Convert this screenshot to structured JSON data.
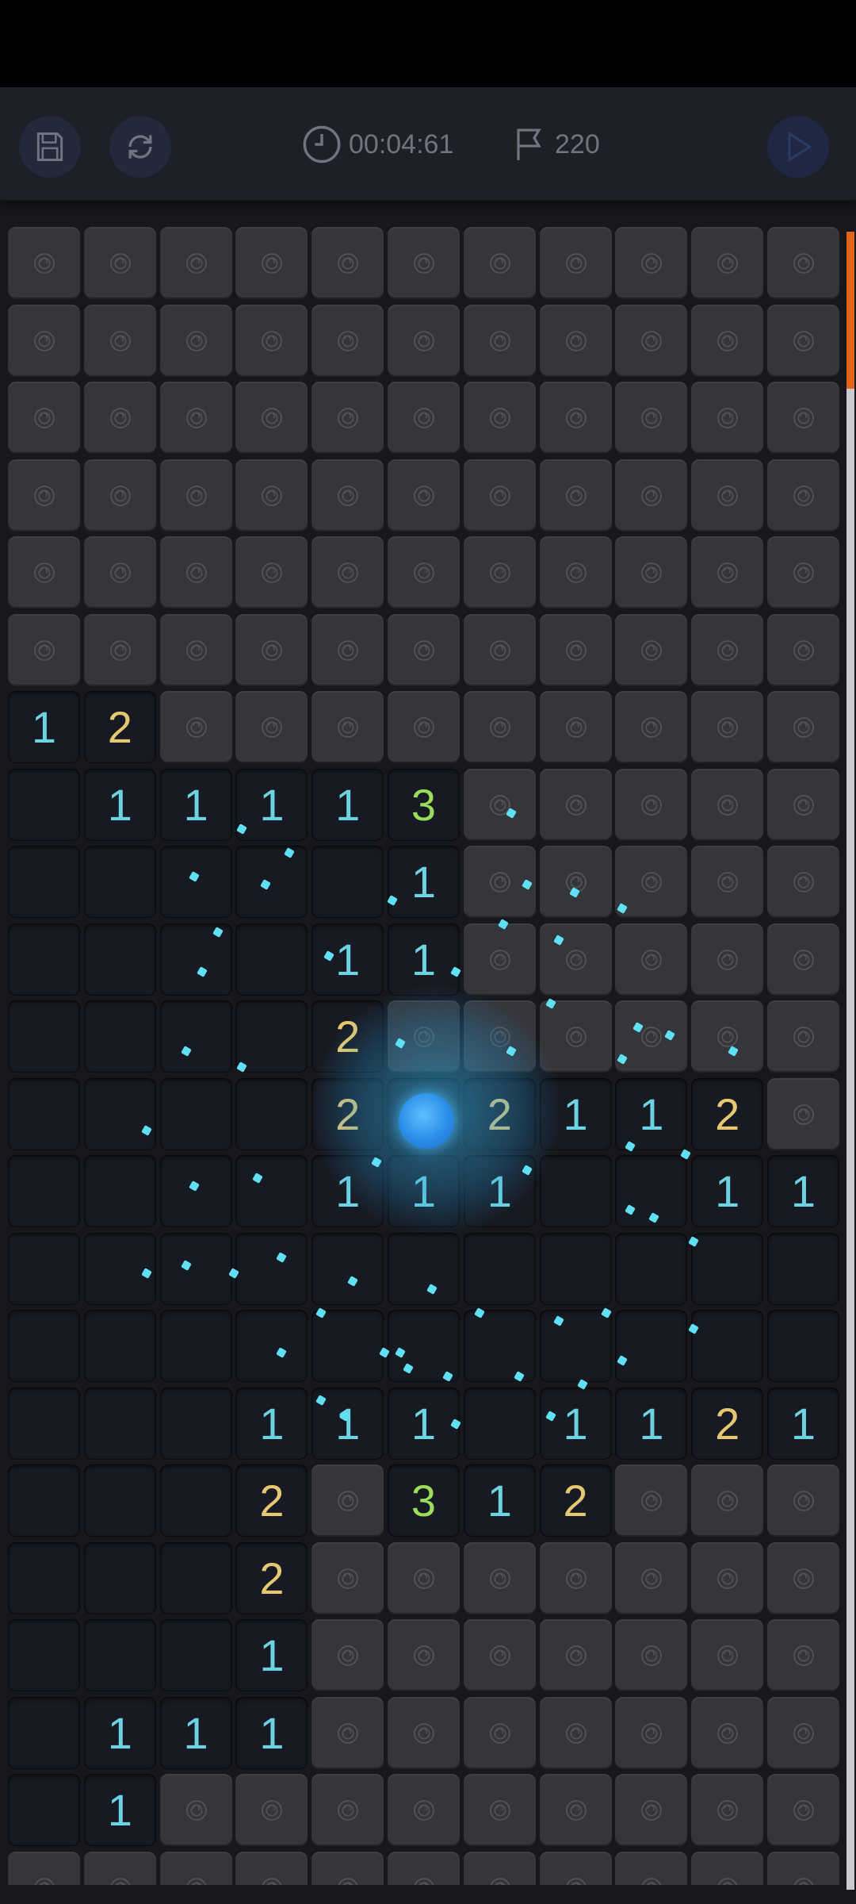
{
  "toolbar": {
    "save_icon": "save-icon",
    "restart_icon": "refresh-icon",
    "timer": "00:04:61",
    "flags": "220",
    "play_icon": "play-icon"
  },
  "colors": {
    "one": "#6cd3e3",
    "two": "#e6c872",
    "three": "#9bdc5a",
    "covered": "#35363b",
    "revealed": "#171a22",
    "scroll_thumb": "#e0661a"
  },
  "board": {
    "cols": 11,
    "rows": [
      "CCCCCCCCCCC",
      "CCCCCCCCCCC",
      "CCCCCCCCCCC",
      "CCCCCCCCCCC",
      "CCCCCCCCCCC",
      "CCCCCCCCCCC",
      "12CCCCCCCCC",
      "01111 3CCCCC",
      "000001CCCCC",
      "00001 1CCCCC",
      "00002CCCCCC",
      "00002 021 12C",
      "00001 11 0011",
      "00000000000",
      "00000000000",
      "00011100 1121",
      "00023 12CCC",
      "0002CCCCCCC",
      "0001CCCCCCC",
      "0111CCCCCCC",
      "01CCCCCCCCC",
      "CCCCCCCCCCC"
    ],
    "grid": [
      [
        "C",
        "C",
        "C",
        "C",
        "C",
        "C",
        "C",
        "C",
        "C",
        "C",
        "C"
      ],
      [
        "C",
        "C",
        "C",
        "C",
        "C",
        "C",
        "C",
        "C",
        "C",
        "C",
        "C"
      ],
      [
        "C",
        "C",
        "C",
        "C",
        "C",
        "C",
        "C",
        "C",
        "C",
        "C",
        "C"
      ],
      [
        "C",
        "C",
        "C",
        "C",
        "C",
        "C",
        "C",
        "C",
        "C",
        "C",
        "C"
      ],
      [
        "C",
        "C",
        "C",
        "C",
        "C",
        "C",
        "C",
        "C",
        "C",
        "C",
        "C"
      ],
      [
        "C",
        "C",
        "C",
        "C",
        "C",
        "C",
        "C",
        "C",
        "C",
        "C",
        "C"
      ],
      [
        "1",
        "2",
        "C",
        "C",
        "C",
        "C",
        "C",
        "C",
        "C",
        "C",
        "C"
      ],
      [
        "0",
        "1",
        "1",
        "1",
        "1",
        "3",
        "C",
        "C",
        "C",
        "C",
        "C"
      ],
      [
        "0",
        "0",
        "0",
        "0",
        "0",
        "1",
        "C",
        "C",
        "C",
        "C",
        "C"
      ],
      [
        "0",
        "0",
        "0",
        "0",
        "1",
        "1",
        "C",
        "C",
        "C",
        "C",
        "C"
      ],
      [
        "0",
        "0",
        "0",
        "0",
        "2",
        "C",
        "C",
        "C",
        "C",
        "C",
        "C"
      ],
      [
        "0",
        "0",
        "0",
        "0",
        "2",
        "0",
        "2",
        "1",
        "1",
        "2",
        "C"
      ],
      [
        "0",
        "0",
        "0",
        "0",
        "1",
        "1",
        "1",
        "0",
        "0",
        "1",
        "1"
      ],
      [
        "0",
        "0",
        "0",
        "0",
        "0",
        "0",
        "0",
        "0",
        "0",
        "0",
        "0"
      ],
      [
        "0",
        "0",
        "0",
        "0",
        "0",
        "0",
        "0",
        "0",
        "0",
        "0",
        "0"
      ],
      [
        "0",
        "0",
        "0",
        "1",
        "1",
        "1",
        "0",
        "1",
        "1",
        "2",
        "1"
      ],
      [
        "0",
        "0",
        "0",
        "2",
        "C",
        "3",
        "1",
        "2",
        "C",
        "C",
        "C"
      ],
      [
        "0",
        "0",
        "0",
        "2",
        "C",
        "C",
        "C",
        "C",
        "C",
        "C",
        "C"
      ],
      [
        "0",
        "0",
        "0",
        "1",
        "C",
        "C",
        "C",
        "C",
        "C",
        "C",
        "C"
      ],
      [
        "0",
        "1",
        "1",
        "1",
        "C",
        "C",
        "C",
        "C",
        "C",
        "C",
        "C"
      ],
      [
        "0",
        "1",
        "C",
        "C",
        "C",
        "C",
        "C",
        "C",
        "C",
        "C",
        "C"
      ],
      [
        "C",
        "C",
        "C",
        "C",
        "C",
        "C",
        "C",
        "C",
        "C",
        "C",
        "C"
      ]
    ]
  },
  "scrollbar": {
    "position": 0.0
  }
}
